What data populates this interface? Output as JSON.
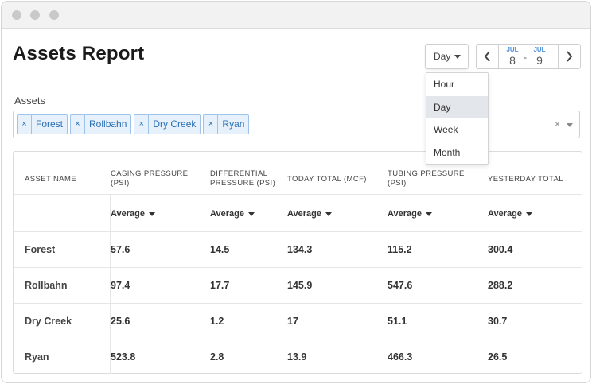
{
  "window": {
    "controls": [
      "close",
      "minimize",
      "maximize"
    ]
  },
  "page": {
    "title": "Assets Report"
  },
  "period": {
    "selected": "Day",
    "options": [
      "Hour",
      "Day",
      "Week",
      "Month"
    ],
    "highlighted": "Day"
  },
  "date_range": {
    "start": {
      "month": "JUL",
      "day": "8"
    },
    "separator": "-",
    "end": {
      "month": "JUL",
      "day": "9"
    }
  },
  "assets": {
    "label": "Assets",
    "selected": [
      "Forest",
      "Rollbahn",
      "Dry Creek",
      "Ryan"
    ],
    "remove_glyph": "×",
    "clear_glyph": "×"
  },
  "table": {
    "columns": [
      {
        "header": "ASSET NAME",
        "header2": "",
        "aggregate": ""
      },
      {
        "header": "CASING PRESSURE",
        "header2": "(PSI)",
        "aggregate": "Average"
      },
      {
        "header": "DIFFERENTIAL",
        "header2": "PRESSURE (PSI)",
        "aggregate": "Average"
      },
      {
        "header": "TODAY TOTAL (MCF)",
        "header2": "",
        "aggregate": "Average"
      },
      {
        "header": "TUBING PRESSURE",
        "header2": "(PSI)",
        "aggregate": "Average"
      },
      {
        "header": "YESTERDAY TOTAL",
        "header2": "",
        "aggregate": "Average"
      }
    ],
    "rows": [
      [
        "Forest",
        "57.6",
        "14.5",
        "134.3",
        "115.2",
        "300.4"
      ],
      [
        "Rollbahn",
        "97.4",
        "17.7",
        "145.9",
        "547.6",
        "288.2"
      ],
      [
        "Dry Creek",
        "25.6",
        "1.2",
        "17",
        "51.1",
        "30.7"
      ],
      [
        "Ryan",
        "523.8",
        "2.8",
        "13.9",
        "466.3",
        "26.5"
      ]
    ]
  },
  "colors": {
    "tag_bg": "#e7f1fb",
    "tag_border": "#9dc3ea",
    "tag_text": "#2a6fb5",
    "date_month": "#4a90d9",
    "selected_option_bg": "#e3e6ea"
  }
}
